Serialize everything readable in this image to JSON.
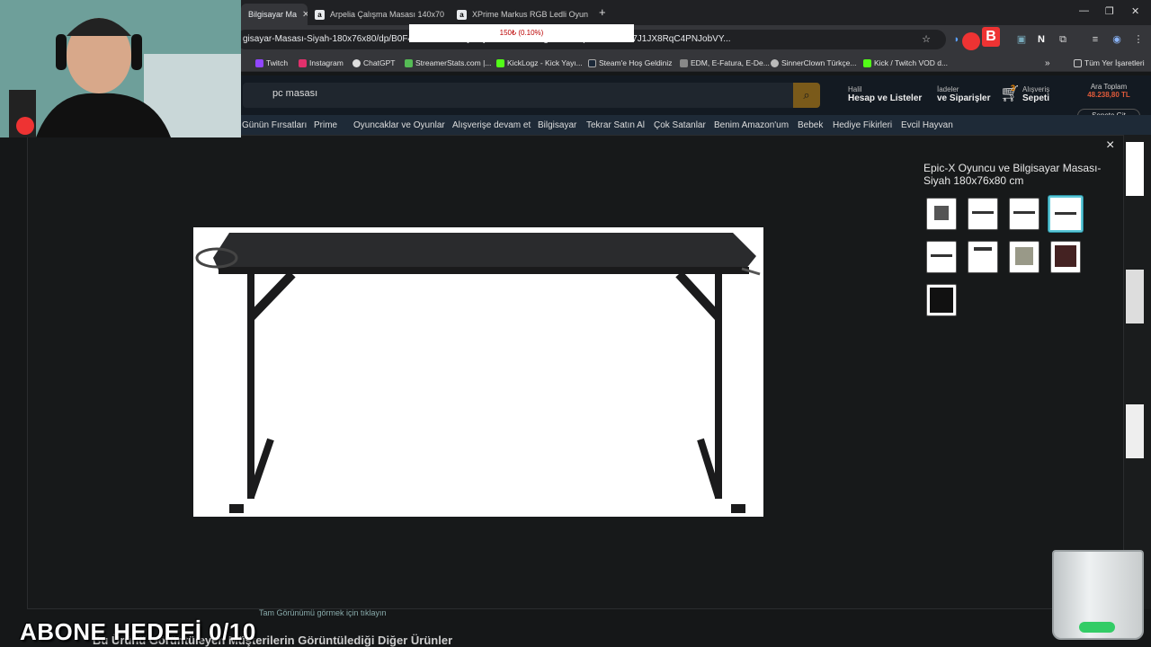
{
  "browser": {
    "tabs": [
      {
        "label": "Bilgisayar Ma",
        "active": true
      },
      {
        "label": "Arpelia Çalışma Masası 140x70",
        "active": false
      },
      {
        "label": "XPrime Markus RGB Ledli Oyun",
        "active": false
      }
    ],
    "new_tab": "+",
    "url": "gisayar-Masası-Siyah-180x76x80/dp/B0F4XYR...&dib=eyJ2IjoiMSJ9.rBNn3g5DKmx4psk-siZOHG7J1JX8RqC4PNJobVY...",
    "bookmarks": [
      "Twitch",
      "Instagram",
      "ChatGPT",
      "StreamerStats.com |...",
      "KickLogz - Kick Yayı...",
      "Steam'e Hoş Geldiniz",
      "EDM, E-Fatura, E-De...",
      "SinnerClown Türkçe...",
      "Kick / Twitch VOD d..."
    ],
    "bookmarks_folder": "Tüm Yer İşaretleri"
  },
  "amazon": {
    "search_query": "pc masası",
    "account_small": "Halil",
    "account_big": "Hesap ve Listeler",
    "orders_small": "İadeler",
    "orders_big": "ve Siparişler",
    "cart_count": "3",
    "cart_small": "Alışveriş",
    "cart_big": "Sepeti",
    "subtotal_label": "Ara Toplam",
    "subtotal_value": "48.238,80 TL",
    "go_to_cart": "Sepete Git",
    "nav": [
      "Günün Fırsatları",
      "Prime",
      "Oyuncaklar ve Oyunlar",
      "Alışverişe devam et",
      "Bilgisayar",
      "Tekrar Satın Al",
      "Çok Satanlar",
      "Benim Amazon'um",
      "Bebek",
      "Hediye Fikirleri",
      "Evcil Hayvan"
    ],
    "modal_title": "Epic-X Oyuncu ve Bilgisayar Masası-Siyah 180x76x80 cm",
    "modal_close": "×",
    "thumbnail_count": 9,
    "selected_thumbnail": 4,
    "full_view_link": "Tam Görünümü görmek için tıklayın",
    "bottom_heading": "Bu Ürünü Görüntüleyen Müşterilerin Görüntülediği Diğer Ürünler"
  },
  "overlay": {
    "donation_text": "150₺ (0.10%)",
    "goal_text": "ABONE HEDEFİ 0/10"
  },
  "colors": {
    "selected_thumb": "#5cc8d8",
    "subtotal": "#e05a3a",
    "background": "#151718"
  }
}
